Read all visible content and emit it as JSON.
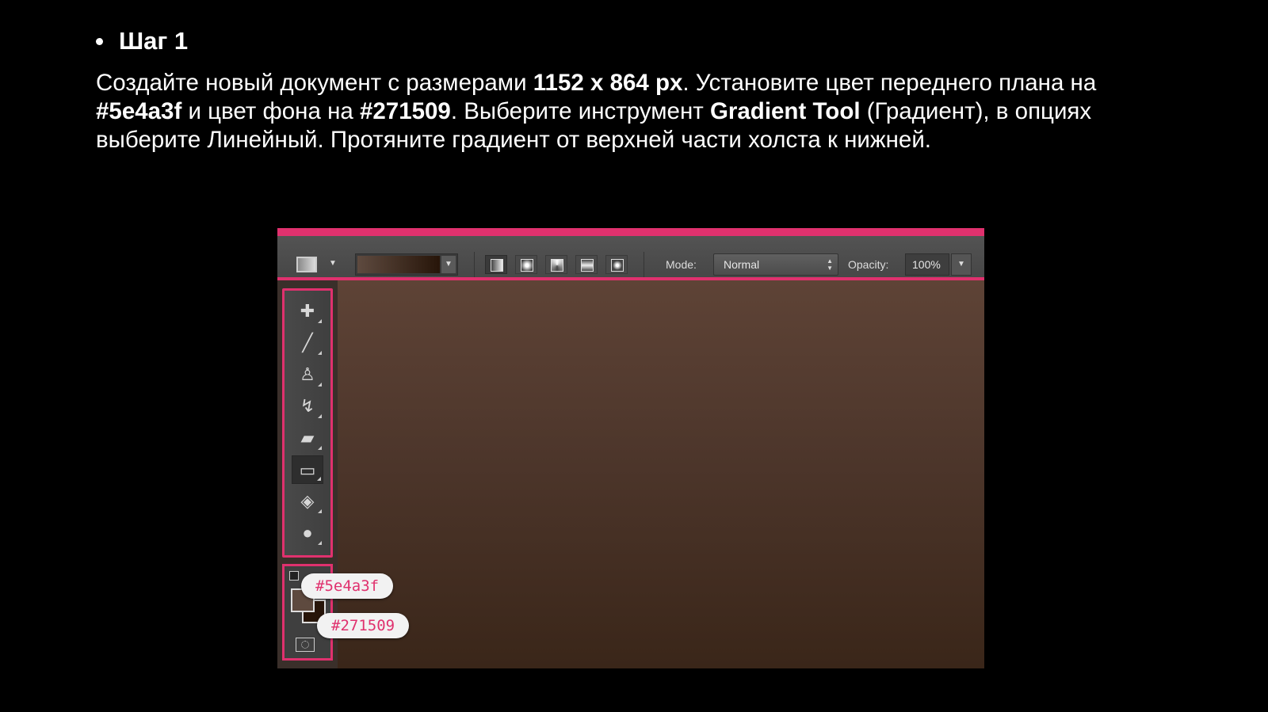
{
  "slide": {
    "heading": "Шаг 1",
    "text": {
      "p1": "Создайте новый документ с размерами ",
      "size": "1152 x 864 px",
      "p2": ". Установите цвет переднего плана на  ",
      "fg_color": "#5e4a3f",
      "p3": " и цвет фона на  ",
      "bg_color": "#271509",
      "p4": ". Выберите инструмент ",
      "tool_name": "Gradient Tool",
      "p5": " (Градиент), в опциях выберите Линейный. Протяните градиент от верхней части холста к нижней."
    }
  },
  "options_bar": {
    "mode_label": "Mode:",
    "mode_value": "Normal",
    "opacity_label": "Opacity:",
    "opacity_value": "100%",
    "gradient_types": [
      "linear-gradient-icon",
      "radial-gradient-icon",
      "angle-gradient-icon",
      "reflected-gradient-icon",
      "diamond-gradient-icon"
    ],
    "active_gradient_type": "linear-gradient-icon"
  },
  "toolbar": {
    "tools": [
      {
        "name": "spot-healing-brush-icon",
        "glyph": "✚"
      },
      {
        "name": "brush-icon",
        "glyph": "╱"
      },
      {
        "name": "clone-stamp-icon",
        "glyph": "♙"
      },
      {
        "name": "history-brush-icon",
        "glyph": "↯"
      },
      {
        "name": "eraser-icon",
        "glyph": "▰"
      },
      {
        "name": "gradient-tool-icon",
        "glyph": "▭"
      },
      {
        "name": "blur-tool-icon",
        "glyph": "◈"
      },
      {
        "name": "dodge-tool-icon",
        "glyph": "●"
      }
    ],
    "active_tool": "gradient-tool-icon"
  },
  "colors": {
    "foreground_label": "#5e4a3f",
    "background_label": "#271509",
    "foreground_hex": "#5e4a3f",
    "background_hex": "#271509",
    "accent_hex": "#e0316e"
  }
}
